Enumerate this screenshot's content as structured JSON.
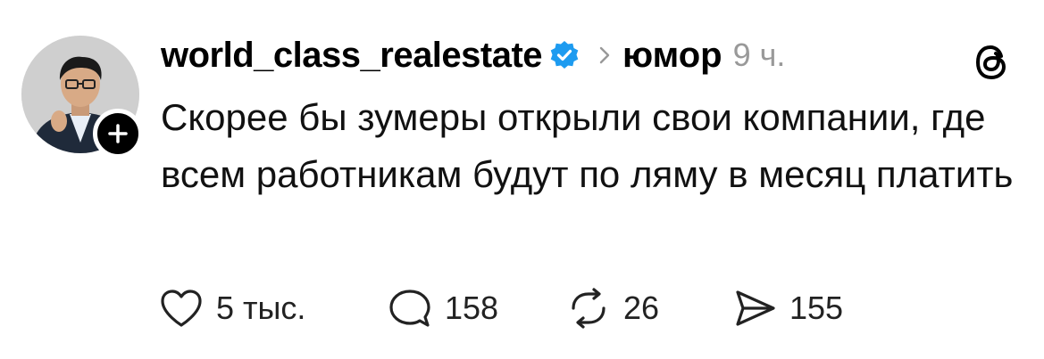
{
  "post": {
    "username": "world_class_realestate",
    "topic": "юмор",
    "time": "9 ч.",
    "text": "Скорее бы зумеры открыли свои компании, где всем работникам будут по ляму в месяц платить"
  },
  "actions": {
    "likes": "5 тыс.",
    "comments": "158",
    "reposts": "26",
    "shares": "155"
  },
  "colors": {
    "verified": "#1d9bf0",
    "muted": "#999999",
    "text": "#000000"
  },
  "icons": {
    "avatar": "profile-photo",
    "follow": "plus-icon",
    "verified": "verified-badge-icon",
    "separator": "chevron-right-icon",
    "logo": "threads-logo-icon",
    "like": "heart-icon",
    "comment": "speech-bubble-icon",
    "repost": "repost-icon",
    "share": "send-icon"
  }
}
